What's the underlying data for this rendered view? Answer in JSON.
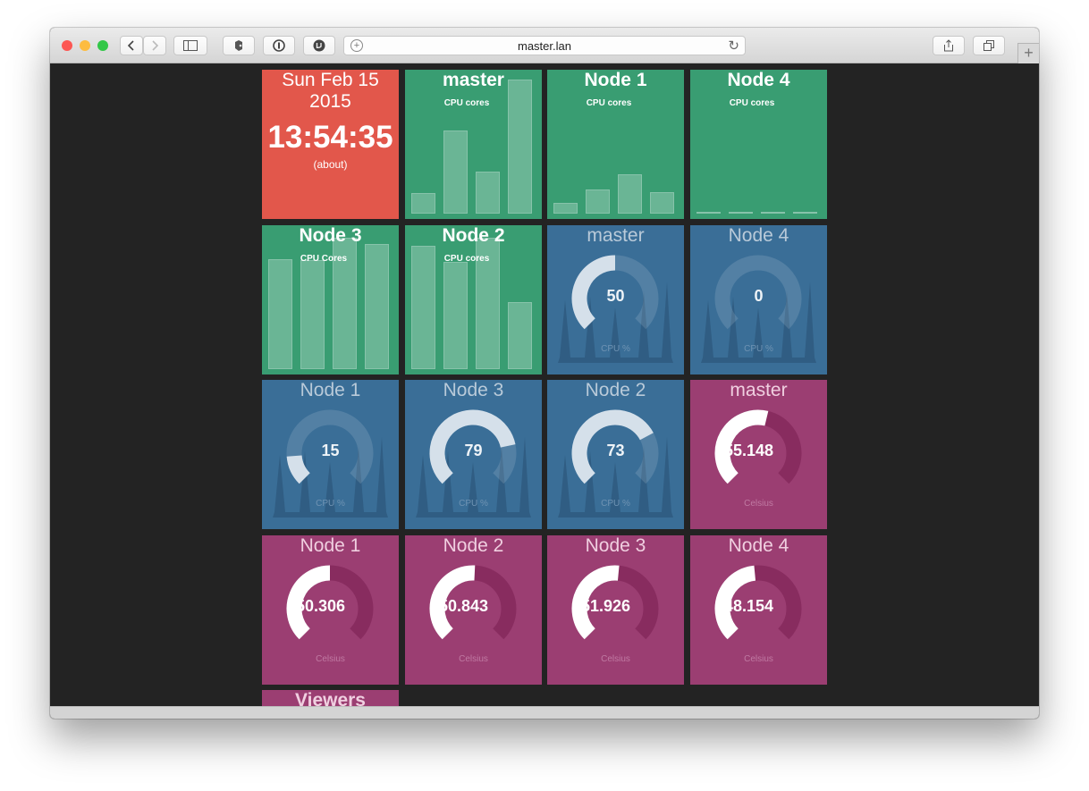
{
  "browser": {
    "url": "master.lan",
    "new_tab_glyph": "+",
    "colors": {
      "close": "#fc5753",
      "minimize": "#fdbc40",
      "zoom": "#33c748"
    }
  },
  "clock": {
    "date": "Sun Feb 15 2015",
    "time": "13:54:35",
    "about": "(about)"
  },
  "cpu_cores": [
    {
      "title": "master",
      "sub": "CPU cores",
      "values": [
        0.15,
        0.62,
        0.31,
        1.0
      ]
    },
    {
      "title": "Node 1",
      "sub": "CPU cores",
      "values": [
        0.08,
        0.18,
        0.29,
        0.16
      ]
    },
    {
      "title": "Node 4",
      "sub": "CPU cores",
      "values": [
        0.0,
        0.0,
        0.0,
        0.0
      ]
    },
    {
      "title": "Node 3",
      "sub": "CPU Cores",
      "values": [
        0.82,
        0.81,
        0.98,
        0.93
      ]
    },
    {
      "title": "Node 2",
      "sub": "CPU cores",
      "values": [
        0.92,
        0.8,
        0.98,
        0.5
      ]
    }
  ],
  "cpu_pct": [
    {
      "title": "master",
      "value": "50",
      "label": "CPU %",
      "pct": 50
    },
    {
      "title": "Node 4",
      "value": "0",
      "label": "CPU %",
      "pct": 0
    },
    {
      "title": "Node 1",
      "value": "15",
      "label": "CPU %",
      "pct": 15
    },
    {
      "title": "Node 3",
      "value": "79",
      "label": "CPU %",
      "pct": 79
    },
    {
      "title": "Node 2",
      "value": "73",
      "label": "CPU %",
      "pct": 73
    }
  ],
  "temps": [
    {
      "title": "master",
      "value": "55.148",
      "label": "Celsius",
      "pct": 55
    },
    {
      "title": "Node 1",
      "value": "50.306",
      "label": "Celsius",
      "pct": 50
    },
    {
      "title": "Node 2",
      "value": "50.843",
      "label": "Celsius",
      "pct": 51
    },
    {
      "title": "Node 3",
      "value": "51.926",
      "label": "Celsius",
      "pct": 52
    },
    {
      "title": "Node 4",
      "value": "48.154",
      "label": "Celsius",
      "pct": 48
    }
  ],
  "viewers": {
    "title": "Viewers"
  },
  "icons": [
    "back-chevron-icon",
    "forward-chevron-icon",
    "sidebar-icon",
    "evernote-icon",
    "1password-icon",
    "ublock-icon",
    "share-icon",
    "tabs-icon",
    "reload-icon",
    "add-icon"
  ]
}
